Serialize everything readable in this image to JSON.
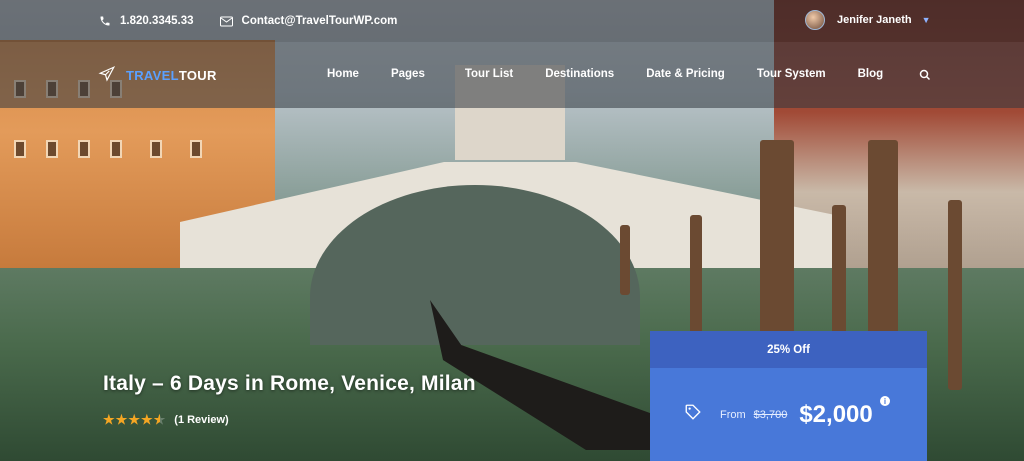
{
  "topbar": {
    "phone": "1.820.3345.33",
    "email": "Contact@TravelTourWP.com",
    "user_name": "Jenifer Janeth"
  },
  "logo": {
    "part1": "TRAVEL",
    "part2": "TOUR"
  },
  "nav": {
    "items": [
      "Home",
      "Pages",
      "Tour List",
      "Destinations",
      "Date & Pricing",
      "Tour System",
      "Blog"
    ]
  },
  "tour": {
    "title": "Italy – 6 Days in Rome, Venice, Milan",
    "rating_stars": 4.5,
    "reviews": "(1 Review)"
  },
  "price": {
    "discount": "25% Off",
    "from_label": "From",
    "old_price": "$3,700",
    "new_price": "$2,000",
    "info_symbol": "i"
  },
  "colors": {
    "accent": "#5aa0ff",
    "price_bg": "#4878d9",
    "discount_bg": "#3d62c0",
    "star": "#f5a623"
  },
  "icons": [
    "phone-icon",
    "mail-icon",
    "plane-icon",
    "search-icon",
    "chevron-down-icon",
    "tag-icon",
    "info-icon",
    "star-icon"
  ]
}
